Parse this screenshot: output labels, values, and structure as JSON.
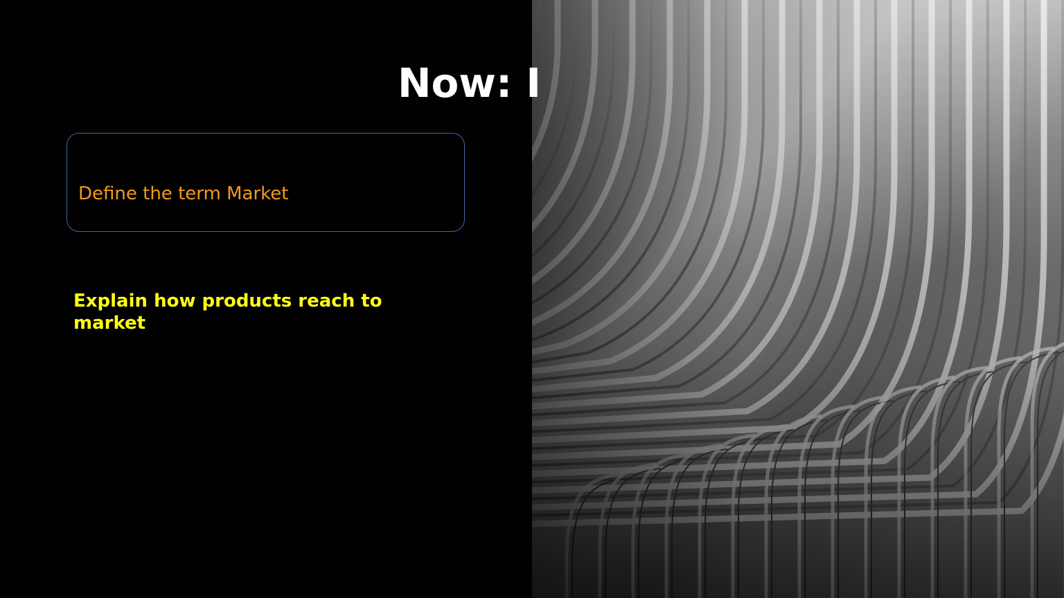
{
  "slide": {
    "title": "Now: I",
    "box_text": "Define the term Market",
    "explain_text": "Explain how products reach to market",
    "photo": "architecture-photo",
    "colors": {
      "background": "#020102",
      "title": "#ffffff",
      "box_border": "#4a63a8",
      "box_text": "#f29a1f",
      "explain_text": "#ffff14"
    }
  }
}
